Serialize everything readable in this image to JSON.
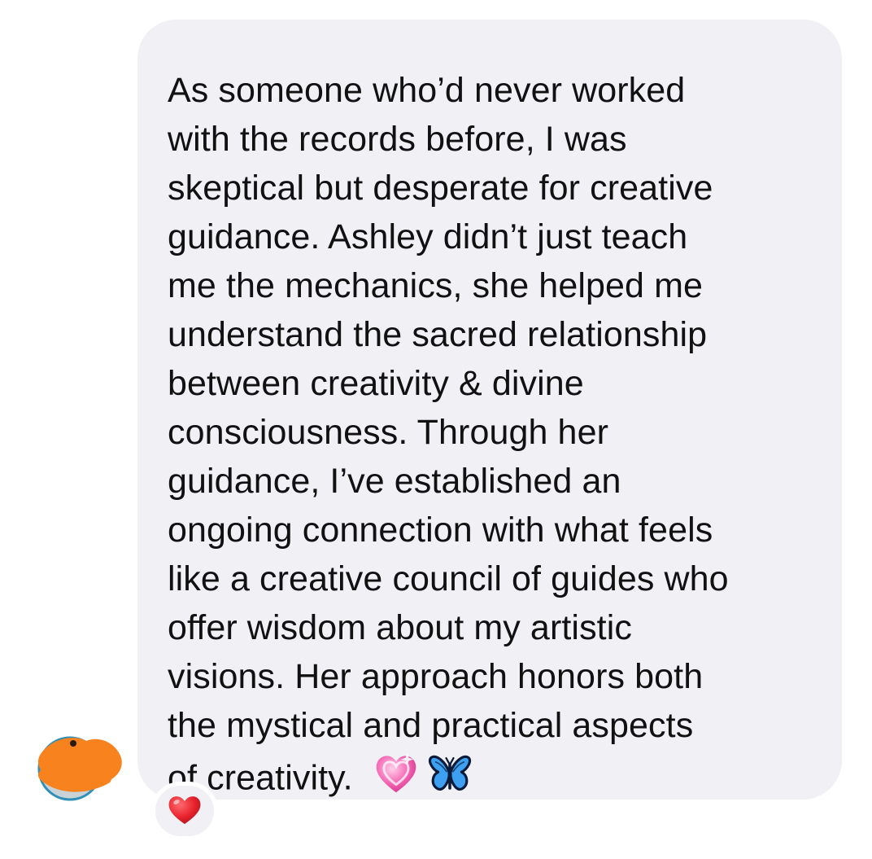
{
  "message": {
    "lines": [
      "As someone who’d never worked",
      "with the records before, I was",
      "skeptical but desperate for creative",
      "guidance. Ashley didn’t just teach",
      "me the mechanics, she helped me",
      "understand the sacred relationship",
      "between creativity & divine",
      "consciousness. Through her",
      "guidance, I’ve established an",
      "ongoing connection with what feels",
      "like a creative council of guides who",
      "offer wisdom about my artistic",
      "visions. Her approach honors both",
      "the mystical and practical aspects",
      "of creativity."
    ],
    "emojis": [
      "sparkling-heart-icon",
      "butterfly-icon"
    ],
    "bubble_color": "#f0f0f5",
    "text_color": "#111111"
  },
  "avatar": {
    "icon": "avatar-obscured",
    "overlay_color": "#f7821e"
  },
  "reaction": {
    "icon": "red-heart-icon",
    "color": "#e0202c"
  }
}
